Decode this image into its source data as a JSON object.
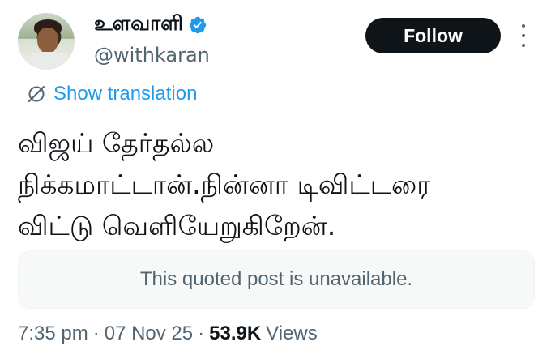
{
  "author": {
    "display_name": "உளவாளி",
    "handle": "@withkaran",
    "verified_color": "#1d9bf0"
  },
  "follow_button": {
    "label": "Follow"
  },
  "translation": {
    "label": "Show translation",
    "icon": "translate-icon"
  },
  "tweet": {
    "text": "விஜய் தேர்தல்ல\nநிக்கமாட்டான்.நின்னா டிவிட்டரை\nவிட்டு வெளியேறுகிறேன்."
  },
  "quote": {
    "text": "This quoted post is unavailable."
  },
  "meta": {
    "time": "7:35 pm",
    "separator1": "·",
    "date": "07 Nov 25",
    "separator2": "·",
    "views_count": "53.9K",
    "views_label": "Views"
  },
  "colors": {
    "accent": "#1d9bf0",
    "text": "#0f1419",
    "secondary": "#536471"
  }
}
